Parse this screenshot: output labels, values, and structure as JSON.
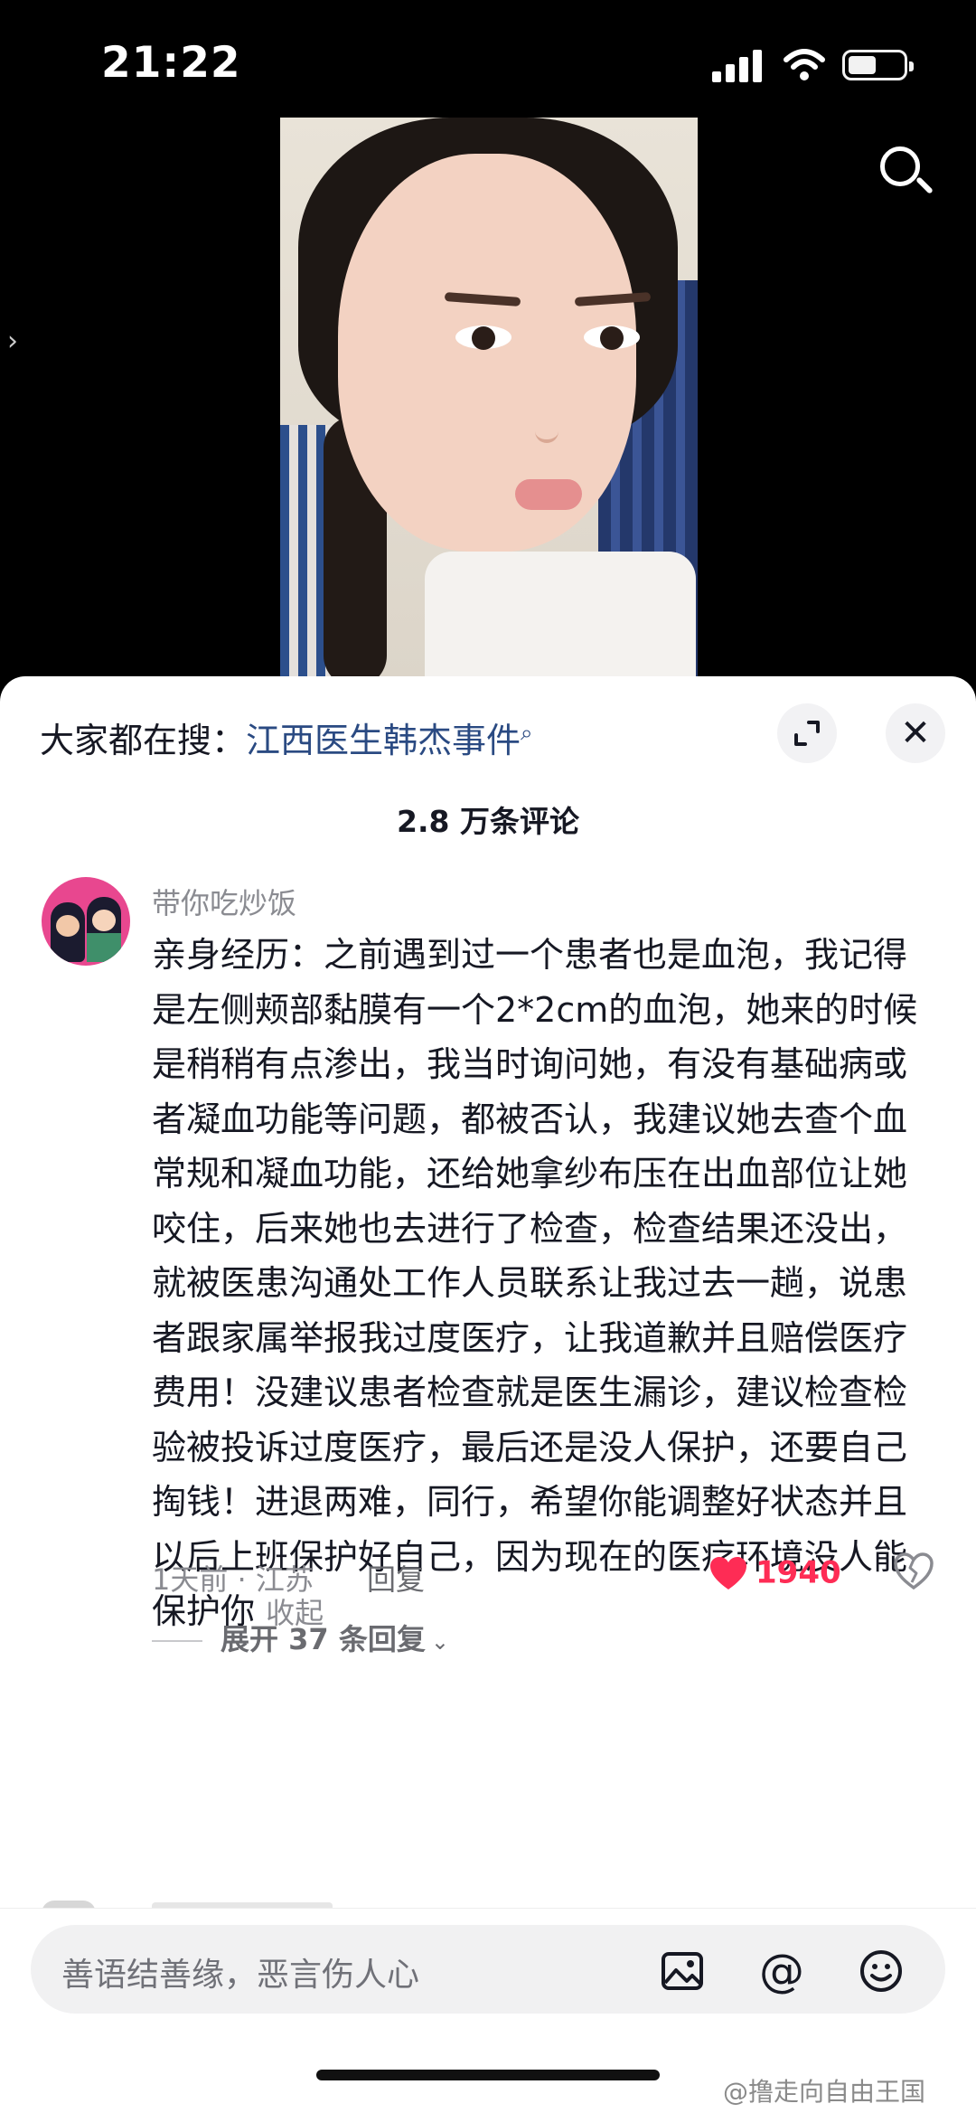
{
  "status_bar": {
    "time": "21:22"
  },
  "sheet": {
    "trending_prefix": "大家都在搜：",
    "trending_keyword": "江西医生韩杰事件",
    "comment_count": "2.8 万条评论"
  },
  "comment": {
    "username": "带你吃炒饭",
    "text": "亲身经历：之前遇到过一个患者也是血泡，我记得是左侧颊部黏膜有一个2*2cm的血泡，她来的时候是稍稍有点渗出，我当时询问她，有没有基础病或者凝血功能等问题，都被否认，我建议她去查个血常规和凝血功能，还给她拿纱布压在出血部位让她咬住，后来她也去进行了检查，检查结果还没出，就被医患沟通处工作人员联系让我过去一趟，说患者跟家属举报我过度医疗，让我道歉并且赔偿医疗费用！没建议患者检查就是医生漏诊，建议检查检验被投诉过度医疗，最后还是没人保护，还要自己掏钱！进退两难，同行，希望你能调整好状态并且以后上班保护好自己，因为现在的医疗环境没人能保护你",
    "collapse_label": "收起",
    "time_location": "1天前 · 江苏",
    "reply_label": "回复",
    "like_count": "1940",
    "expand_replies_label": "展开 37 条回复"
  },
  "input": {
    "placeholder": "善语结善缘，恶言伤人心"
  },
  "watermark": "@撸走向自由王国",
  "icons": {
    "search": "search-icon",
    "expand": "expand-icon",
    "close": "close-icon",
    "heart": "heart-icon",
    "dislike": "broken-heart-icon",
    "image": "image-icon",
    "at": "at-icon",
    "emoji": "emoji-icon"
  },
  "colors": {
    "like": "#fe2c55",
    "keyword": "#2a4a82",
    "meta": "#8a8b91"
  }
}
